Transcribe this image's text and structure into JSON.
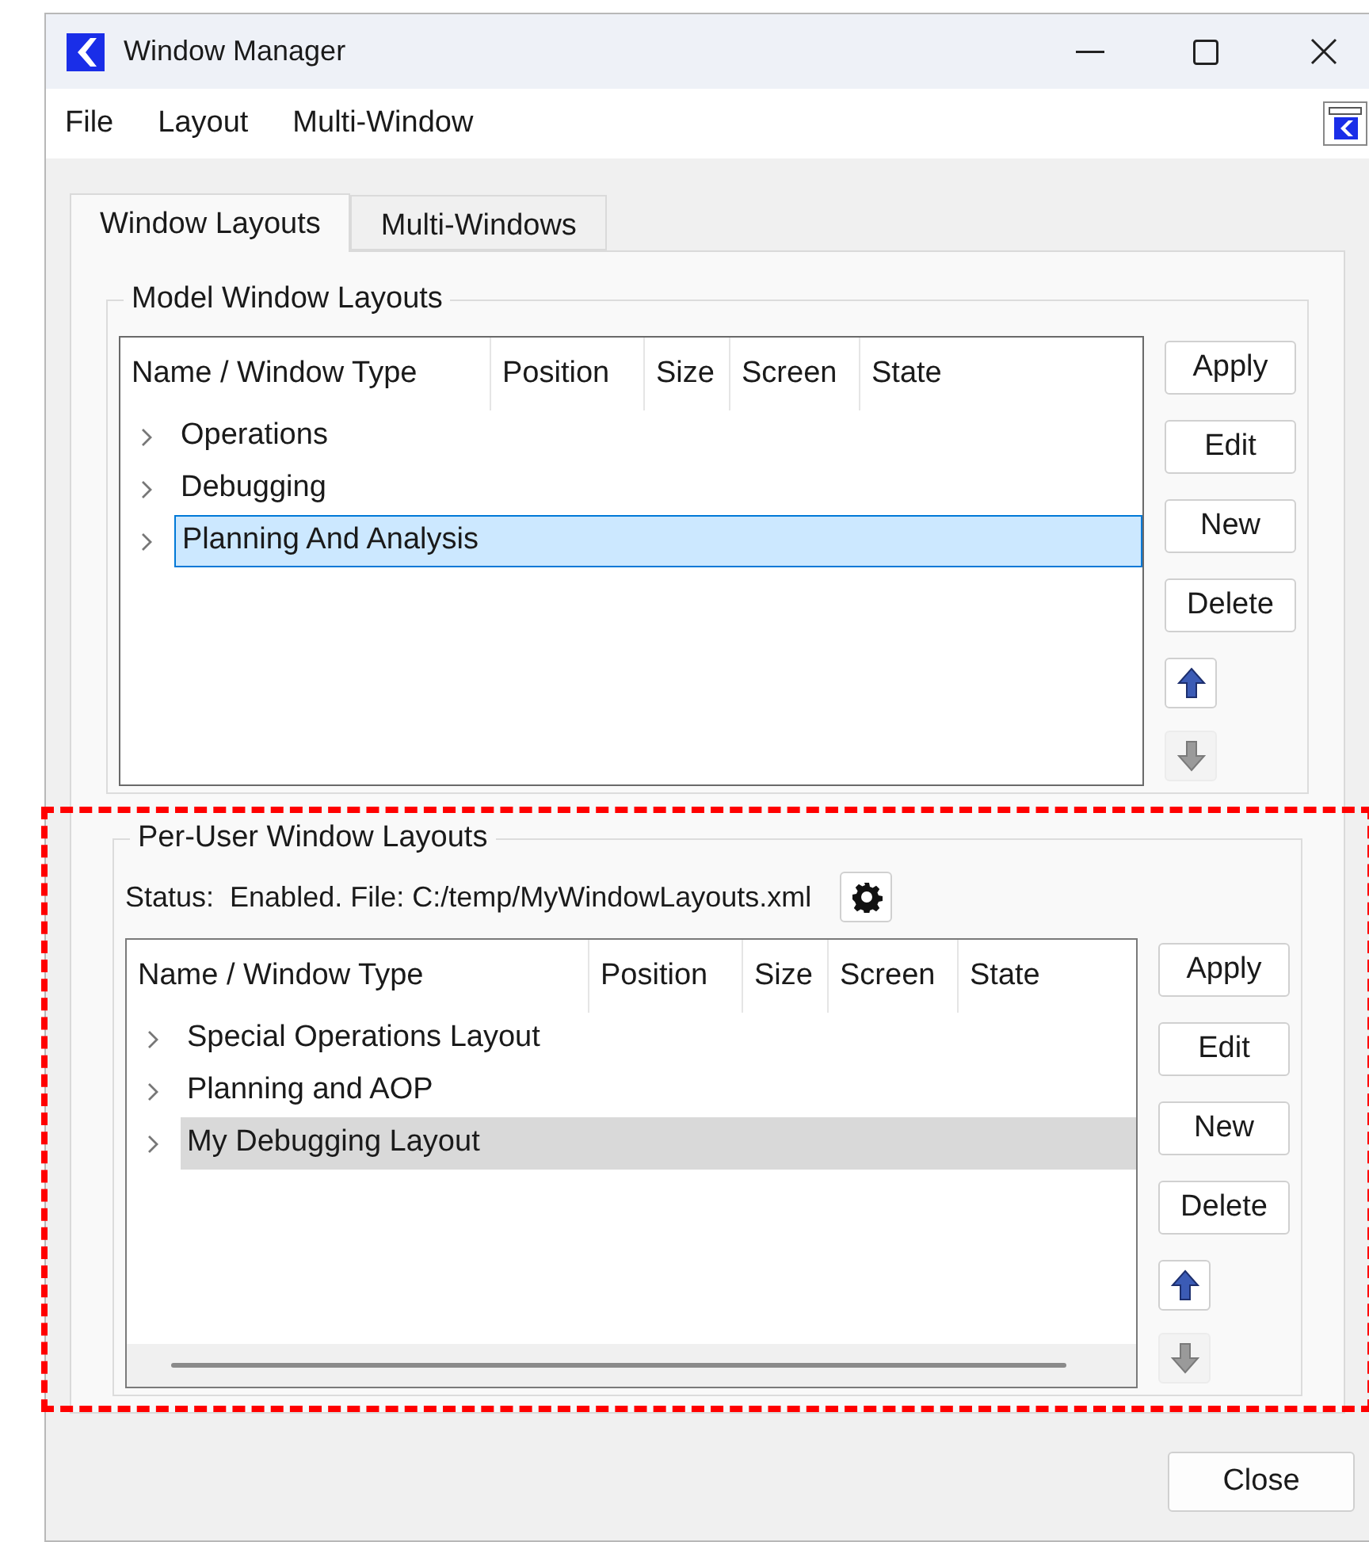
{
  "window": {
    "title": "Window Manager"
  },
  "menu": [
    "File",
    "Layout",
    "Multi-Window"
  ],
  "tabs": [
    {
      "label": "Window Layouts",
      "selected": true
    },
    {
      "label": "Multi-Windows",
      "selected": false
    }
  ],
  "model_layouts": {
    "title": "Model Window Layouts",
    "highlighted": false,
    "focused": true,
    "scrollbar": false,
    "columns": [
      "Name / Window Type",
      "Position",
      "Size",
      "Screen",
      "State"
    ],
    "rows": [
      {
        "name": "Operations",
        "selected": false
      },
      {
        "name": "Debugging",
        "selected": false
      },
      {
        "name": "Planning And Analysis",
        "selected": true
      }
    ],
    "buttons": [
      "Apply",
      "Edit",
      "New",
      "Delete"
    ],
    "move_up": {
      "disabled": false
    },
    "move_down": {
      "disabled": true
    }
  },
  "user_layouts": {
    "title": "Per-User Window Layouts",
    "highlighted": true,
    "focused": false,
    "scrollbar": true,
    "status_label": "Status:",
    "status": "Enabled. File: C:/temp/MyWindowLayouts.xml",
    "columns": [
      "Name / Window Type",
      "Position",
      "Size",
      "Screen",
      "State"
    ],
    "rows": [
      {
        "name": "Special Operations Layout",
        "selected": false
      },
      {
        "name": "Planning and AOP",
        "selected": false
      },
      {
        "name": "My Debugging Layout",
        "selected": true
      }
    ],
    "buttons": [
      "Apply",
      "Edit",
      "New",
      "Delete"
    ],
    "move_up": {
      "disabled": false
    },
    "move_down": {
      "disabled": true
    }
  },
  "close_button": "Close"
}
